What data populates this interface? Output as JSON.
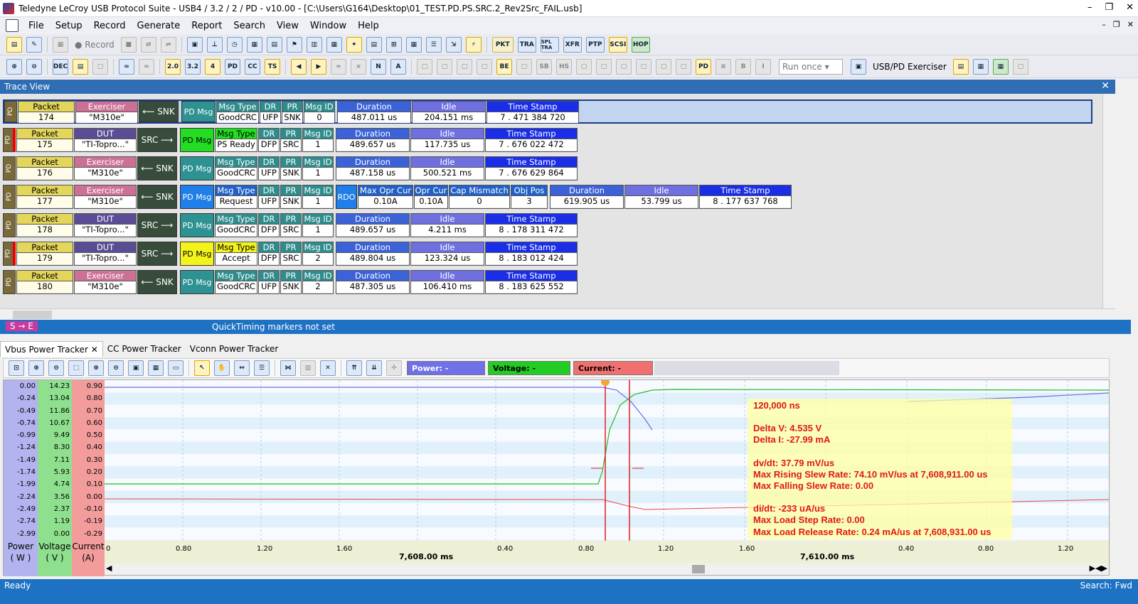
{
  "window": {
    "title": "Teledyne LeCroy USB Protocol Suite - USB4 / 3.2 / 2 / PD - v10.00 - [C:\\Users\\G164\\Desktop\\01_TEST.PD.PS.SRC.2_Rev2Src_FAIL.usb]"
  },
  "menu": [
    "File",
    "Setup",
    "Record",
    "Generate",
    "Report",
    "Search",
    "View",
    "Window",
    "Help"
  ],
  "toolbar1": {
    "record_label": "Record",
    "buttons": [
      "PKT",
      "TRA",
      "SPL TRA",
      "XFR",
      "PTP",
      "SCSI",
      "HOP"
    ]
  },
  "toolbar2": {
    "run_select": "Run once",
    "exerciser_label": "USB/PD Exerciser",
    "zoom_labels": [
      "DEC",
      "3.2",
      "PD",
      "CC"
    ]
  },
  "trace_view": {
    "title": "Trace View",
    "headers": {
      "packet": "Packet",
      "msg_type": "Msg Type",
      "dr": "DR",
      "pr": "PR",
      "msg_id": "Msg ID",
      "duration": "Duration",
      "idle": "Idle",
      "time_stamp": "Time Stamp",
      "pd_msg": "PD Msg",
      "pd": "PD",
      "rdo": "RDO",
      "max_opr_cur": "Max Opr Cur",
      "opr_cur": "Opr Cur",
      "cap_mismatch": "Cap Mismatch",
      "obj_pos": "Obj Pos"
    },
    "rows": [
      {
        "packet": "174",
        "role": "Exerciser",
        "device": "\"M310e\"",
        "dir": "SNK",
        "msg_type": "GoodCRC",
        "dr": "UFP",
        "pr": "SNK",
        "msg_id": "0",
        "duration": "487.011 us",
        "idle": "204.151 ms",
        "time_stamp": "7 . 471 384 720"
      },
      {
        "packet": "175",
        "role": "DUT",
        "device": "\"TI-Topro...\"",
        "dir": "SRC",
        "msg_type": "PS Ready",
        "dr": "DFP",
        "pr": "SRC",
        "msg_id": "1",
        "duration": "489.657 us",
        "idle": "117.735 us",
        "time_stamp": "7 . 676 022 472"
      },
      {
        "packet": "176",
        "role": "Exerciser",
        "device": "\"M310e\"",
        "dir": "SNK",
        "msg_type": "GoodCRC",
        "dr": "UFP",
        "pr": "SNK",
        "msg_id": "1",
        "duration": "487.158 us",
        "idle": "500.521 ms",
        "time_stamp": "7 . 676 629 864"
      },
      {
        "packet": "177",
        "role": "Exerciser",
        "device": "\"M310e\"",
        "dir": "SNK",
        "msg_type": "Request",
        "dr": "UFP",
        "pr": "SNK",
        "msg_id": "1",
        "max_opr_cur": "0.10A",
        "opr_cur": "0.10A",
        "cap_mismatch": "0",
        "obj_pos": "3",
        "duration": "619.905 us",
        "idle": "53.799 us",
        "time_stamp": "8 . 177 637 768"
      },
      {
        "packet": "178",
        "role": "DUT",
        "device": "\"TI-Topro...\"",
        "dir": "SRC",
        "msg_type": "GoodCRC",
        "dr": "DFP",
        "pr": "SRC",
        "msg_id": "1",
        "duration": "489.657 us",
        "idle": "4.211 ms",
        "time_stamp": "8 . 178 311 472"
      },
      {
        "packet": "179",
        "role": "DUT",
        "device": "\"TI-Topro...\"",
        "dir": "SRC",
        "msg_type": "Accept",
        "dr": "DFP",
        "pr": "SRC",
        "msg_id": "2",
        "duration": "489.804 us",
        "idle": "123.324 us",
        "time_stamp": "8 . 183 012 424"
      },
      {
        "packet": "180",
        "role": "Exerciser",
        "device": "\"M310e\"",
        "dir": "SNK",
        "msg_type": "GoodCRC",
        "dr": "UFP",
        "pr": "SNK",
        "msg_id": "2",
        "duration": "487.305 us",
        "idle": "106.410 ms",
        "time_stamp": "8 . 183 625 552"
      }
    ]
  },
  "quicktiming": {
    "markers": "S → E",
    "message": "QuickTiming markers not set"
  },
  "power_tabs": [
    "Vbus Power Tracker",
    "CC Power Tracker",
    "Vconn Power Tracker"
  ],
  "legend": {
    "power": "Power: -",
    "voltage": "Voltage: -",
    "current": "Current: -"
  },
  "axes": {
    "power": [
      "0.00",
      "-0.24",
      "-0.49",
      "-0.74",
      "-0.99",
      "-1.24",
      "-1.49",
      "-1.74",
      "-1.99",
      "-2.24",
      "-2.49",
      "-2.74",
      "-2.99"
    ],
    "voltage": [
      "14.23",
      "13.04",
      "11.86",
      "10.67",
      "9.49",
      "8.30",
      "7.11",
      "5.93",
      "4.74",
      "3.56",
      "2.37",
      "1.19",
      "0.00"
    ],
    "current": [
      "0.90",
      "0.80",
      "0.70",
      "0.60",
      "0.50",
      "0.40",
      "0.30",
      "0.20",
      "0.10",
      "0.00",
      "-0.10",
      "-0.19",
      "-0.29"
    ],
    "power_label": "Power",
    "power_unit": "( W )",
    "voltage_label": "Voltage",
    "voltage_unit": "( V )",
    "current_label": "Current",
    "current_unit": "(A)",
    "x_ticks": [
      "0",
      "0.80",
      "1.20",
      "1.60",
      "0.40",
      "0.80",
      "1.20",
      "1.60",
      "0.40",
      "0.80",
      "1.20"
    ],
    "x_major": [
      "7,608.00 ms",
      "7,610.00 ms"
    ]
  },
  "annotation": {
    "time": "120,000 ns",
    "delta_v": "Delta V: 4.535 V",
    "delta_i": "Delta I: -27.99 mA",
    "dvdt": "dv/dt: 37.79 mV/us",
    "max_rising": "Max Rising Slew Rate: 74.10 mV/us at 7,608,911.00 us",
    "max_falling": "Max Falling Slew Rate: 0.00",
    "didt": "di/dt: -233 uA/us",
    "max_load_step": "Max Load Step Rate: 0.00",
    "max_load_release": "Max Load Release Rate: 0.24 mA/us at 7,608,931.00 us"
  },
  "status": {
    "left": "Ready",
    "right": "Search: Fwd"
  },
  "colors": {
    "accent": "#1e72c4",
    "power": "#7070e8",
    "voltage": "#22cc22",
    "current": "#ee4444"
  }
}
